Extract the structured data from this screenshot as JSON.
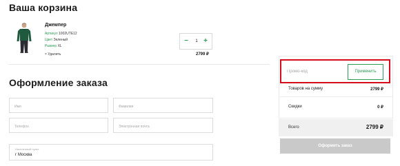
{
  "cart": {
    "title": "Ваша корзина",
    "item": {
      "name": "Джемпер",
      "article_label": "Артикул",
      "article_value": "1002UTE12",
      "color_label": "Цвет",
      "color_value": "Зеленый",
      "size_label": "Размер",
      "size_value": "XL",
      "remove_label": "× Удалить",
      "quantity": "1",
      "minus": "−",
      "plus": "+",
      "price": "2799 ₽",
      "image_icon": "green-sweater-photo"
    }
  },
  "checkout": {
    "title": "Оформление заказа",
    "fields": {
      "name_placeholder": "Имя",
      "surname_placeholder": "Фамилия",
      "phone_placeholder": "Телефон",
      "email_placeholder": "Электронная почта",
      "city_label": "Населенный пункт",
      "city_value": "г Москва"
    }
  },
  "summary": {
    "promo_placeholder": "Промо-код",
    "apply_label": "Применить",
    "goods_label": "Товаров на сумму",
    "goods_value": "2799 ₽",
    "discount_label": "Скидки",
    "discount_value": "0 ₽",
    "total_label": "Всего",
    "total_value": "2799 ₽",
    "submit_label": "Оформить заказ",
    "highlight_color": "#d50d1a",
    "accent_color": "#2e9c55"
  }
}
